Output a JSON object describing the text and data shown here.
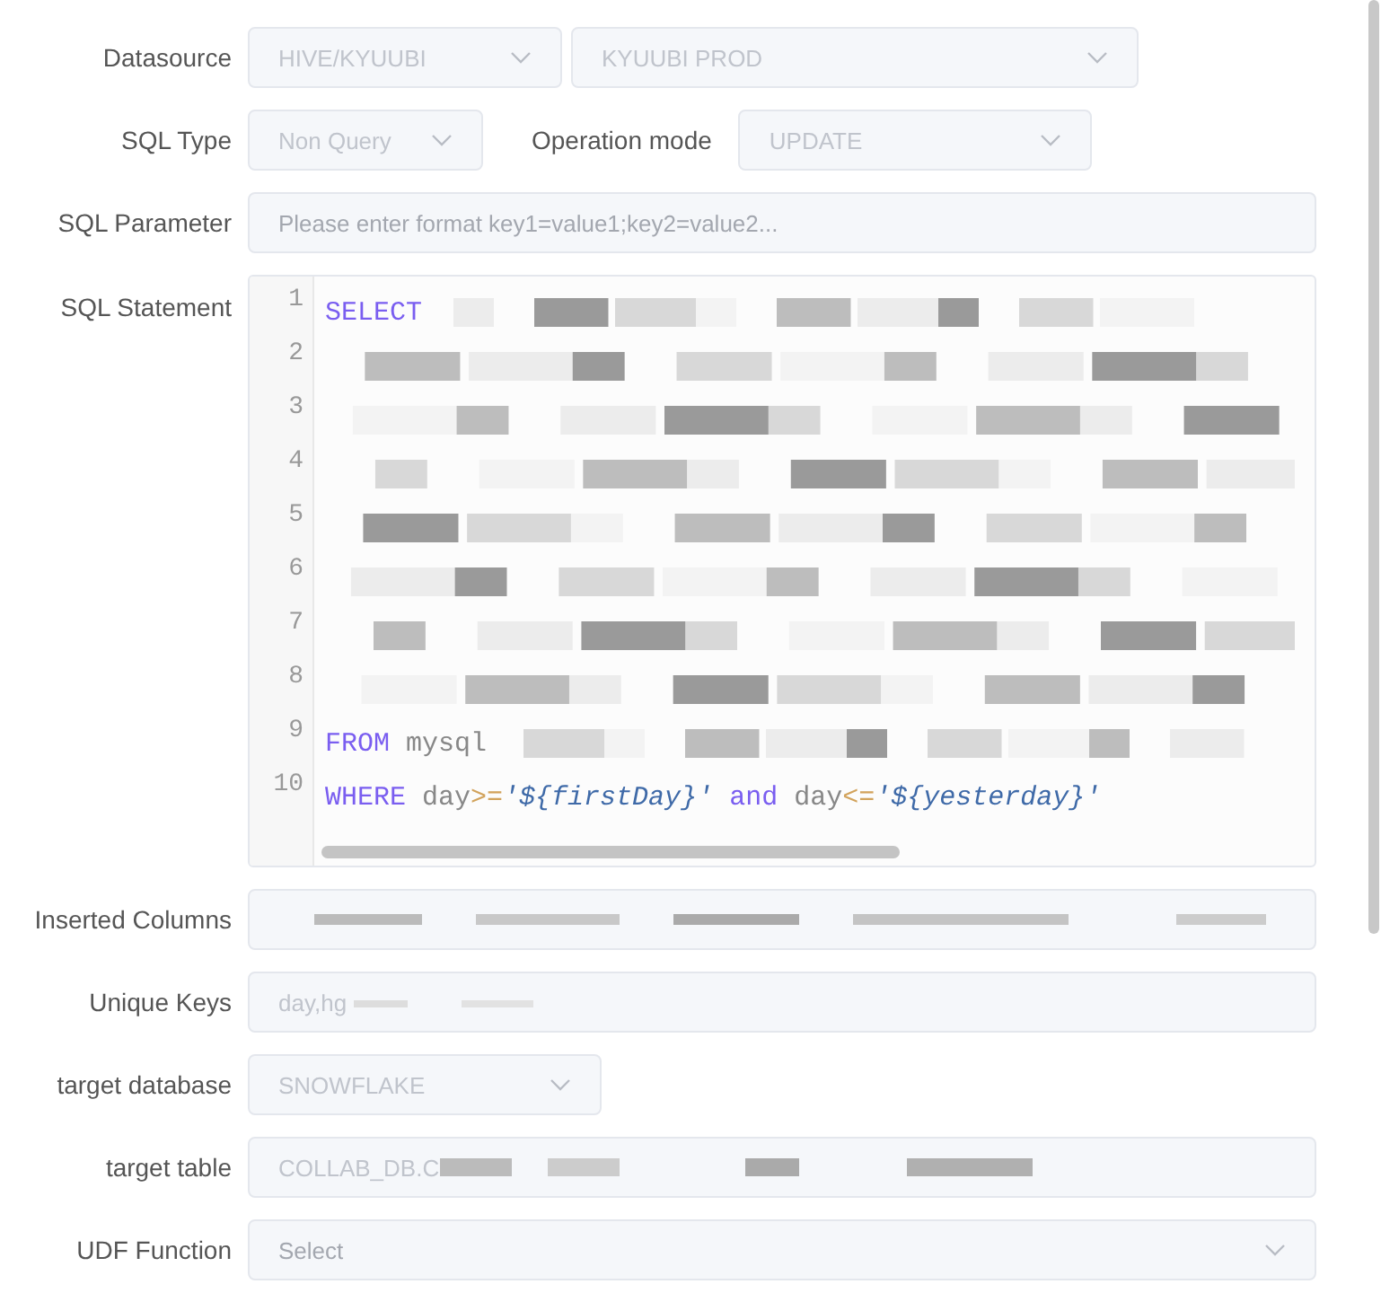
{
  "form": {
    "disabled": true
  },
  "datasource": {
    "label": "Datasource",
    "type": {
      "value": "HIVE/KYUUBI"
    },
    "instance": {
      "value": "KYUUBI PROD"
    }
  },
  "sql_type": {
    "label": "SQL Type",
    "value": "Non Query"
  },
  "operation_mode": {
    "label": "Operation mode",
    "value": "UPDATE"
  },
  "sql_parameter": {
    "label": "SQL Parameter",
    "placeholder": "Please enter format key1=value1;key2=value2..."
  },
  "sql_statement": {
    "label": "SQL Statement",
    "lines": [
      {
        "number": "1",
        "redacted": true,
        "tokens": [
          {
            "kind": "keyword",
            "text": "SELECT"
          }
        ]
      },
      {
        "number": "2",
        "redacted": true
      },
      {
        "number": "3",
        "redacted": true
      },
      {
        "number": "4",
        "redacted": true
      },
      {
        "number": "5",
        "redacted": true
      },
      {
        "number": "6",
        "redacted": true
      },
      {
        "number": "7",
        "redacted": true
      },
      {
        "number": "8",
        "redacted": true
      },
      {
        "number": "9",
        "redacted": true,
        "tokens": [
          {
            "kind": "keyword",
            "text": "FROM"
          },
          {
            "kind": "plain",
            "text": " mysql"
          }
        ]
      },
      {
        "number": "10",
        "redacted": false,
        "tokens": [
          {
            "kind": "keyword",
            "text": "WHERE"
          },
          {
            "kind": "plain",
            "text": " day"
          },
          {
            "kind": "operator",
            "text": ">="
          },
          {
            "kind": "string",
            "text": "'${firstDay}'"
          },
          {
            "kind": "keyword",
            "text": " and"
          },
          {
            "kind": "plain",
            "text": " day"
          },
          {
            "kind": "operator",
            "text": "<="
          },
          {
            "kind": "string",
            "text": "'${yesterday}'"
          }
        ]
      }
    ]
  },
  "inserted_columns": {
    "label": "Inserted Columns",
    "redacted": true
  },
  "unique_keys": {
    "label": "Unique Keys",
    "value": "day,hg",
    "redacted": true
  },
  "target_database": {
    "label": "target database",
    "value": "SNOWFLAKE"
  },
  "target_table": {
    "label": "target table",
    "value": "COLLAB_DB.C",
    "redacted": true
  },
  "udf_function": {
    "label": "UDF Function",
    "placeholder": "Select"
  }
}
